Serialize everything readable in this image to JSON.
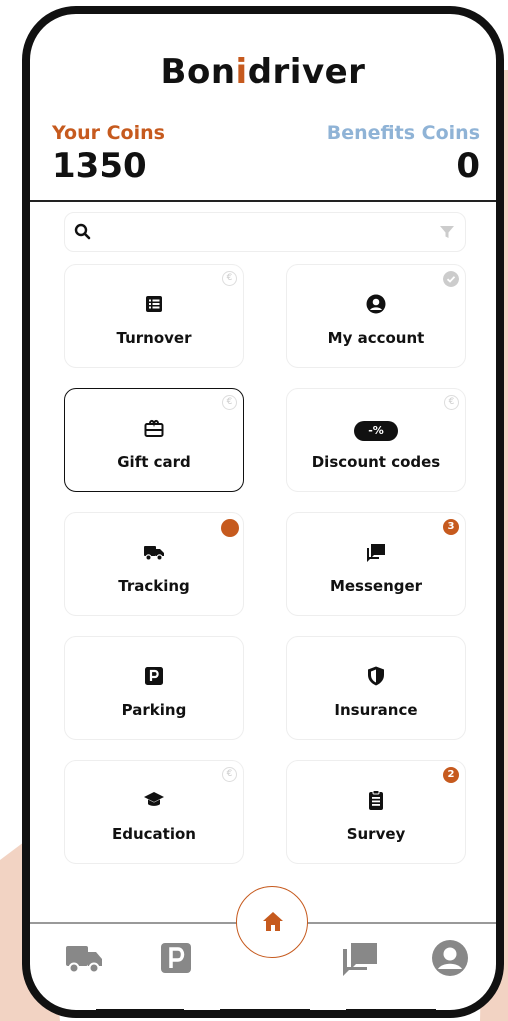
{
  "app": {
    "title_prefix": "Bon",
    "title_accent": "i",
    "title_suffix": "driver"
  },
  "coins": {
    "your_label": "Your Coins",
    "your_value": "1350",
    "benefits_label": "Benefits Coins",
    "benefits_value": "0"
  },
  "search": {
    "value": "",
    "placeholder": ""
  },
  "tiles": [
    {
      "label": "Turnover",
      "icon": "list-icon",
      "marker": "euro"
    },
    {
      "label": "My account",
      "icon": "user-circle-icon",
      "marker": "check"
    },
    {
      "label": "Gift card",
      "icon": "gift-card-icon",
      "marker": "euro",
      "selected": true
    },
    {
      "label": "Discount codes",
      "icon": "discount-tag-icon",
      "marker": "euro"
    },
    {
      "label": "Tracking",
      "icon": "truck-icon",
      "marker": "dot"
    },
    {
      "label": "Messenger",
      "icon": "chat-icon",
      "marker": "badge",
      "badge": "3"
    },
    {
      "label": "Parking",
      "icon": "parking-icon",
      "marker": "none"
    },
    {
      "label": "Insurance",
      "icon": "shield-icon",
      "marker": "none"
    },
    {
      "label": "Education",
      "icon": "graduation-cap-icon",
      "marker": "euro"
    },
    {
      "label": "Survey",
      "icon": "clipboard-icon",
      "marker": "badge",
      "badge": "2"
    }
  ],
  "markers": {
    "euro_symbol": "€"
  },
  "discount_tag_text": "-%",
  "bottom_nav": [
    {
      "name": "truck-icon"
    },
    {
      "name": "parking-icon"
    },
    {
      "name": "home-icon"
    },
    {
      "name": "chat-icon"
    },
    {
      "name": "user-circle-icon"
    }
  ],
  "colors": {
    "accent": "#c65a1e",
    "benefits": "#8fb3d6",
    "background_peach": "#f2d3c3"
  }
}
